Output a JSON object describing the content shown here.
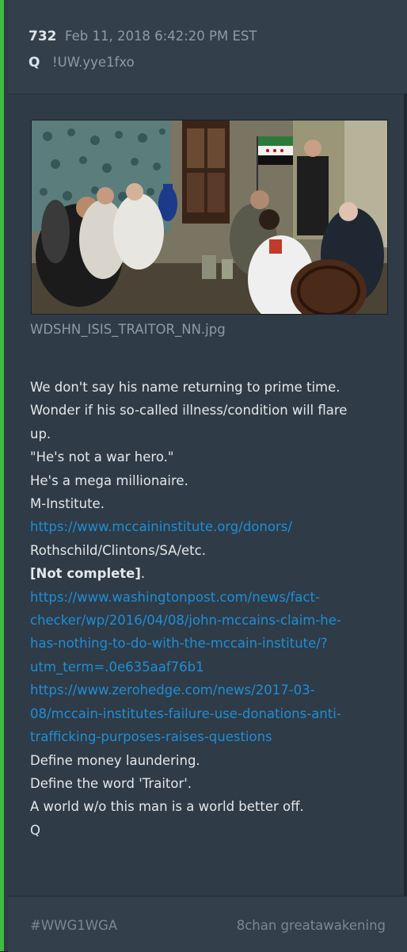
{
  "post": {
    "number": "732",
    "date": "Feb 11, 2018 6:42:20 PM EST",
    "author": "Q",
    "tripcode": "!UW.yye1fxo"
  },
  "image": {
    "filename": "WDSHN_ISIS_TRAITOR_NN.jpg"
  },
  "body_lines": [
    {
      "text": "We don't say his name returning to prime time.",
      "style": "normal"
    },
    {
      "text": "Wonder if his so-called illness/condition will flare",
      "style": "normal"
    },
    {
      "text": "up.",
      "style": "normal"
    },
    {
      "text": "\"He's not a war hero.\"",
      "style": "normal"
    },
    {
      "text": "He's a mega millionaire.",
      "style": "normal"
    },
    {
      "text": "M-Institute.",
      "style": "normal"
    },
    {
      "text": "https://www.mccaininstitute.org/donors/",
      "style": "link"
    },
    {
      "text": "Rothschild/Clintons/SA/etc.",
      "style": "normal"
    },
    {
      "text": "[Not complete]",
      "style": "bold",
      "suffix": "."
    },
    {
      "text": "https://www.washingtonpost.com/news/fact-",
      "style": "link"
    },
    {
      "text": "checker/wp/2016/04/08/john-mccains-claim-he-",
      "style": "link"
    },
    {
      "text": "has-nothing-to-do-with-the-mccain-institute/?",
      "style": "link"
    },
    {
      "text": "utm_term=.0e635aaf76b1",
      "style": "link"
    },
    {
      "text": "https://www.zerohedge.com/news/2017-03-",
      "style": "link"
    },
    {
      "text": "08/mccain-institutes-failure-use-donations-anti-",
      "style": "link"
    },
    {
      "text": "trafficking-purposes-raises-questions",
      "style": "link"
    },
    {
      "text": "Define money laundering.",
      "style": "normal"
    },
    {
      "text": "Define the word 'Traitor'.",
      "style": "normal"
    },
    {
      "text": "A world w/o this man is a world better off.",
      "style": "normal"
    },
    {
      "text": "Q",
      "style": "normal"
    }
  ],
  "footer": {
    "hashtag": "#WWG1WGA",
    "board": "8chan greatawakening"
  },
  "colors": {
    "accent_bar": "#3bbf3b",
    "link": "#1d8fd6",
    "background": "#2f3b47"
  }
}
